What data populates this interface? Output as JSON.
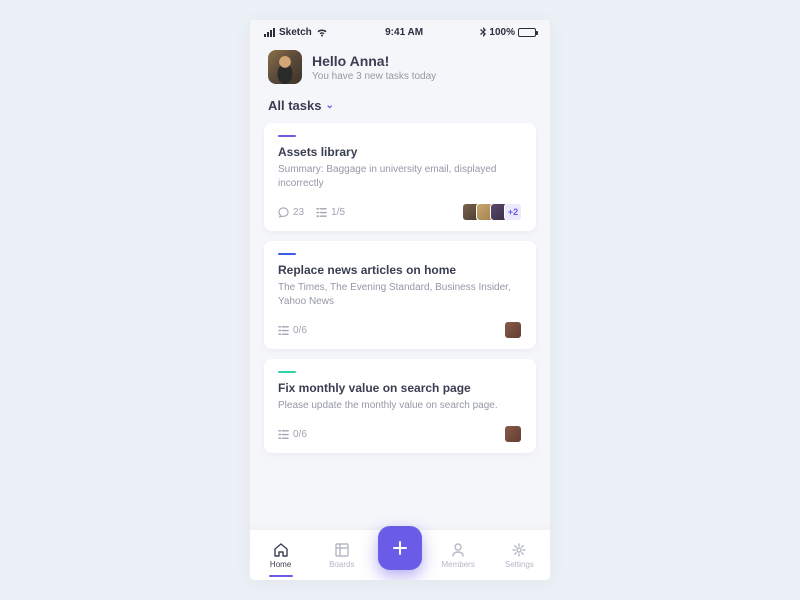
{
  "status": {
    "carrier": "Sketch",
    "time": "9:41 AM",
    "battery": "100%"
  },
  "header": {
    "greeting": "Hello Anna!",
    "subtitle": "You have 3 new tasks today"
  },
  "filter": {
    "label": "All tasks"
  },
  "tasks": [
    {
      "accent": "#6b5ce7",
      "title": "Assets library",
      "desc": "Summary: Baggage in university email, displayed incorrectly",
      "comments": "23",
      "checklist": "1/5",
      "more": "+2"
    },
    {
      "accent": "#3b5ce7",
      "title": "Replace news articles on home",
      "desc": "The Times, The Evening Standard, Business Insider, Yahoo News",
      "checklist": "0/6"
    },
    {
      "accent": "#2dd4a7",
      "title": "Fix monthly value on search page",
      "desc": "Please update the monthly value on search page.",
      "checklist": "0/6"
    }
  ],
  "nav": {
    "home": "Home",
    "boards": "Boards",
    "members": "Members",
    "settings": "Settings"
  }
}
